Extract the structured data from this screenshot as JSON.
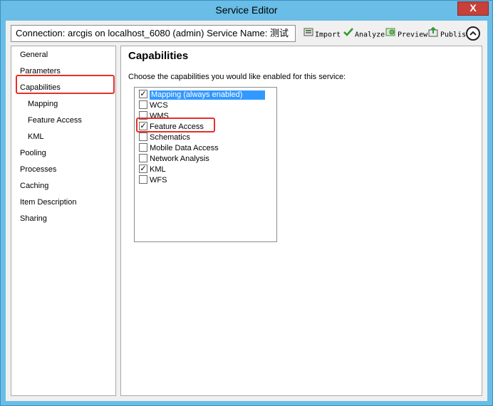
{
  "window": {
    "title": "Service Editor",
    "close_label": "X",
    "accent_color": "#69bde6"
  },
  "toolbar": {
    "connection_text": "Connection: arcgis on localhost_6080 (admin)   Service Name: 测试",
    "import_label": "Import",
    "analyze_label": "Analyze",
    "preview_label": "Preview",
    "publish_label": "Publish",
    "import_icon": "import-icon",
    "analyze_icon": "checkmark-icon",
    "preview_icon": "preview-icon",
    "publish_icon": "publish-icon",
    "collapse_icon": "chevron-up-icon"
  },
  "nav": {
    "items": [
      {
        "label": "General",
        "indent": false
      },
      {
        "label": "Parameters",
        "indent": false
      },
      {
        "label": "Capabilities",
        "indent": false,
        "selected": true
      },
      {
        "label": "Mapping",
        "indent": true
      },
      {
        "label": "Feature Access",
        "indent": true
      },
      {
        "label": "KML",
        "indent": true
      },
      {
        "label": "Pooling",
        "indent": false
      },
      {
        "label": "Processes",
        "indent": false
      },
      {
        "label": "Caching",
        "indent": false
      },
      {
        "label": "Item Description",
        "indent": false
      },
      {
        "label": "Sharing",
        "indent": false
      }
    ],
    "highlight_color": "#e3312b"
  },
  "main": {
    "title": "Capabilities",
    "description": "Choose the capabilities you would like enabled for this service:",
    "capabilities": [
      {
        "label": "Mapping (always enabled)",
        "checked": true,
        "selected": true
      },
      {
        "label": "WCS",
        "checked": false
      },
      {
        "label": "WMS",
        "checked": false
      },
      {
        "label": "Feature Access",
        "checked": true
      },
      {
        "label": "Schematics",
        "checked": false
      },
      {
        "label": "Mobile Data Access",
        "checked": false
      },
      {
        "label": "Network Analysis",
        "checked": false
      },
      {
        "label": "KML",
        "checked": true
      },
      {
        "label": "WFS",
        "checked": false
      }
    ],
    "selection_color": "#3399ff"
  }
}
